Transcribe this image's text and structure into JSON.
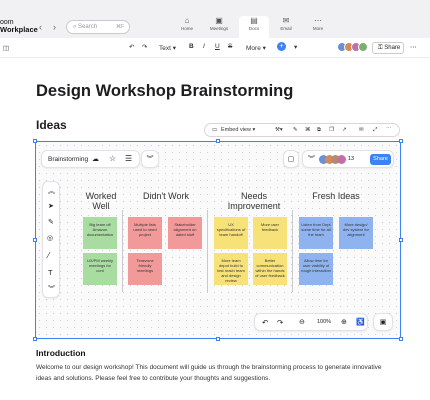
{
  "app": {
    "brand_line1": "oom",
    "brand_line2": "Workplace"
  },
  "search": {
    "placeholder": "Search",
    "shortcut": "⌘F"
  },
  "app_tabs": [
    {
      "label": "Home",
      "icon": "home-icon"
    },
    {
      "label": "Meetings",
      "icon": "meetings-icon"
    },
    {
      "label": "Docs",
      "icon": "docs-icon"
    },
    {
      "label": "Email",
      "icon": "email-icon"
    },
    {
      "label": "More",
      "icon": "more-icon"
    }
  ],
  "toolbar": {
    "text_style": "Text",
    "more": "More",
    "share": "Share"
  },
  "doc": {
    "title": "Design Workshop Brainstorming",
    "section": "Ideas"
  },
  "embed": {
    "view_label": "Embed view"
  },
  "whiteboard": {
    "name": "Brainstorming",
    "participants_count": "13",
    "share": "Share",
    "zoom": "100%",
    "columns": [
      {
        "title": "Worked Well",
        "notes": [
          "Big team off Amazon documentation",
          "UX/PM weekly meetings for cont"
        ]
      },
      {
        "title": "Didn't Work",
        "notes": [
          "Multiple lists used to need project",
          "Stakeholder alignment on dated stuff",
          "Timezone friendly meetings"
        ]
      },
      {
        "title": "Needs Improvement",
        "notes": [
          "UX specifications of team handoff",
          "More user feedback",
          "More team depot build to test reach team and design review",
          "Better communication within the hands of user feedback"
        ]
      },
      {
        "title": "Fresh Ideas",
        "notes": [
          "Listen from Dept some time for all the team",
          "More design/ dev system for alignment",
          "Allow time for user viability of rough interaction"
        ]
      }
    ]
  },
  "intro": {
    "heading": "Introduction",
    "text": "Welcome to our design workshop! This document will guide us through the brainstorming process to generate innovative ideas and solutions. Please feel free to contribute your thoughts and suggestions."
  },
  "colors": {
    "accent": "#3b82f6",
    "green": "#a8dca0",
    "red": "#f29a9a",
    "yellow": "#f7e27a",
    "blue": "#8fb3ee"
  }
}
